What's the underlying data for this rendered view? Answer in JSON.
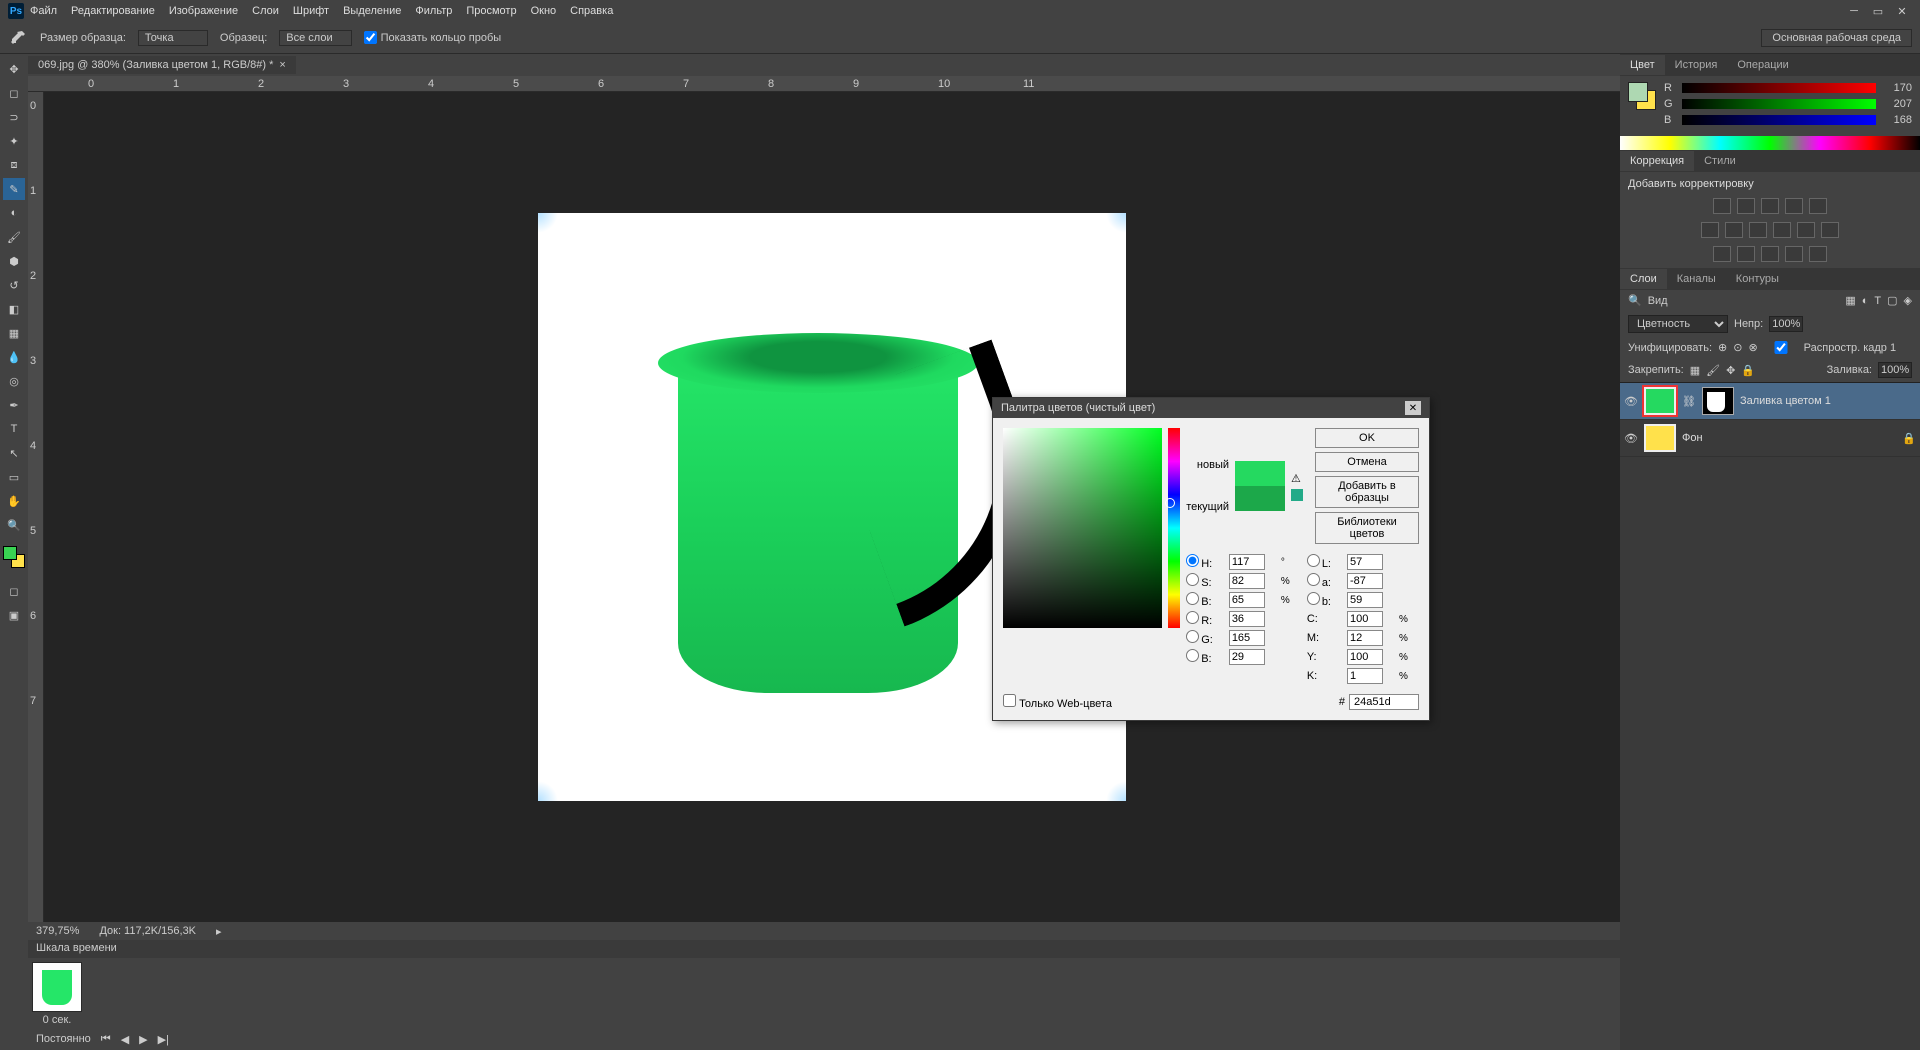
{
  "menubar": [
    "Файл",
    "Редактирование",
    "Изображение",
    "Слои",
    "Шрифт",
    "Выделение",
    "Фильтр",
    "Просмотр",
    "Окно",
    "Справка"
  ],
  "options": {
    "sample_size_label": "Размер образца:",
    "sample_size_value": "Точка",
    "sample_label": "Образец:",
    "sample_value": "Все слои",
    "ring_check": "Показать кольцо пробы",
    "workspace": "Основная рабочая среда"
  },
  "document": {
    "tab": "069.jpg @ 380% (Заливка цветом 1, RGB/8#) *"
  },
  "status": {
    "zoom": "379,75%",
    "info": "Док: 117,2K/156,3K"
  },
  "timeline": {
    "label": "Шкала времени",
    "frame_time": "0 сек.",
    "mode": "Постоянно"
  },
  "panels": {
    "color_tabs": [
      "Цвет",
      "История",
      "Операции"
    ],
    "rgb": {
      "r": "170",
      "g": "207",
      "b": "168"
    },
    "adj_tabs": [
      "Коррекция",
      "Стили"
    ],
    "adj_label": "Добавить корректировку",
    "layer_tabs": [
      "Слои",
      "Каналы",
      "Контуры"
    ],
    "layer_search": "Вид",
    "blend_mode": "Цветность",
    "opacity_label": "Непр:",
    "opacity": "100%",
    "unify_label": "Унифицировать:",
    "propagate": "Распростр. кадр 1",
    "lock_label": "Закрепить:",
    "fill_label": "Заливка:",
    "fill": "100%",
    "layers": [
      {
        "name": "Заливка цветом 1",
        "selected": true,
        "highlighted": true
      },
      {
        "name": "Фон",
        "selected": false
      }
    ]
  },
  "picker": {
    "title": "Палитра цветов (чистый цвет)",
    "new_label": "новый",
    "cur_label": "текущий",
    "buttons": {
      "ok": "OK",
      "cancel": "Отмена",
      "add": "Добавить в образцы",
      "libs": "Библиотеки цветов"
    },
    "web_only": "Только Web-цвета",
    "H": "117",
    "S": "82",
    "B": "65",
    "R": "36",
    "G": "165",
    "Bb": "29",
    "L": "57",
    "a": "-87",
    "b": "59",
    "C": "100",
    "M": "12",
    "Y": "100",
    "K": "1",
    "hex": "24a51d"
  }
}
